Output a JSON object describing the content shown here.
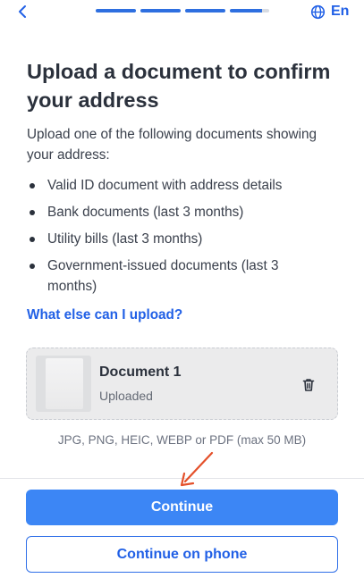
{
  "header": {
    "back_icon": "chevron-left-icon",
    "progress_steps": 4,
    "progress_current": 4,
    "language_icon": "globe-icon",
    "language_label": "En"
  },
  "main": {
    "title": "Upload a document to confirm your address",
    "intro": "Upload one of the following documents showing your address:",
    "documents": [
      "Valid ID document with address details",
      "Bank documents (last 3 months)",
      "Utility bills (last 3 months)",
      "Government-issued documents (last 3 months)"
    ],
    "more_link": "What else can I upload?"
  },
  "upload": {
    "file_title": "Document 1",
    "file_status": "Uploaded",
    "delete_icon": "trash-icon",
    "formats_hint": "JPG, PNG, HEIC, WEBP or PDF (max 50 MB)"
  },
  "footer": {
    "continue_label": "Continue",
    "continue_phone_label": "Continue on phone"
  },
  "colors": {
    "accent": "#2160e6",
    "primary_button": "#3c86f5",
    "annotation_arrow": "#e4502a"
  }
}
